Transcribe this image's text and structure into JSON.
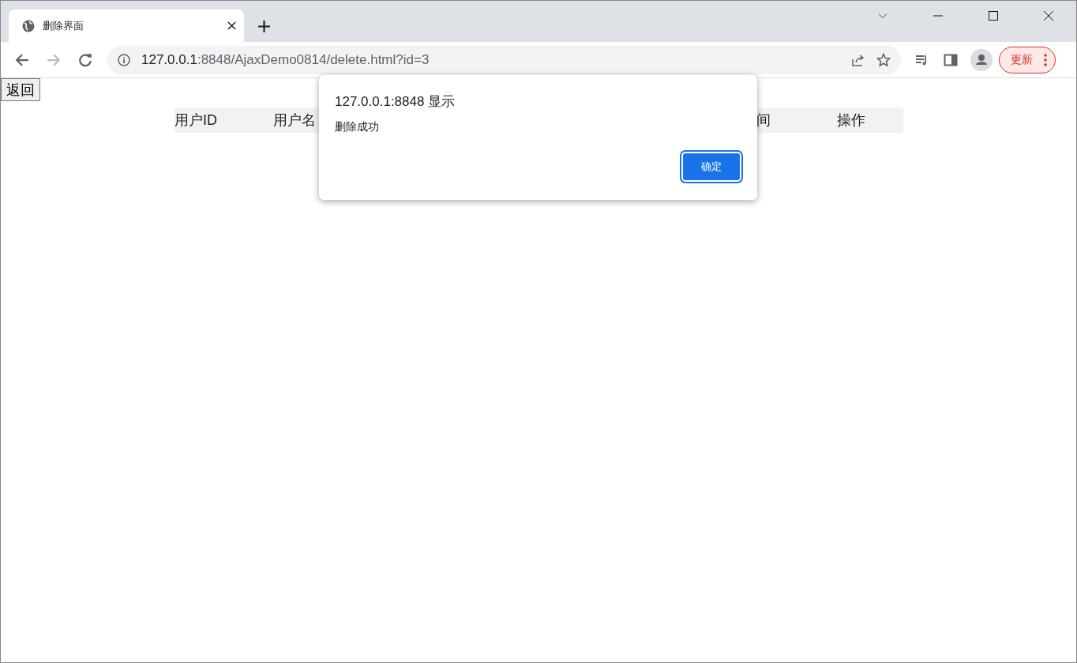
{
  "browser": {
    "tab": {
      "title": "删除界面",
      "selected": true
    },
    "address": {
      "host": "127.0.0.1",
      "rest": ":8848/AjaxDemo0814/delete.html?id=3"
    },
    "update_button": "更新"
  },
  "page": {
    "back_button": "返回",
    "table": {
      "columns": [
        "用户ID",
        "用户名",
        "间",
        "操作"
      ]
    }
  },
  "dialog": {
    "title": "127.0.0.1:8848 显示",
    "message": "删除成功",
    "ok_button": "确定"
  }
}
